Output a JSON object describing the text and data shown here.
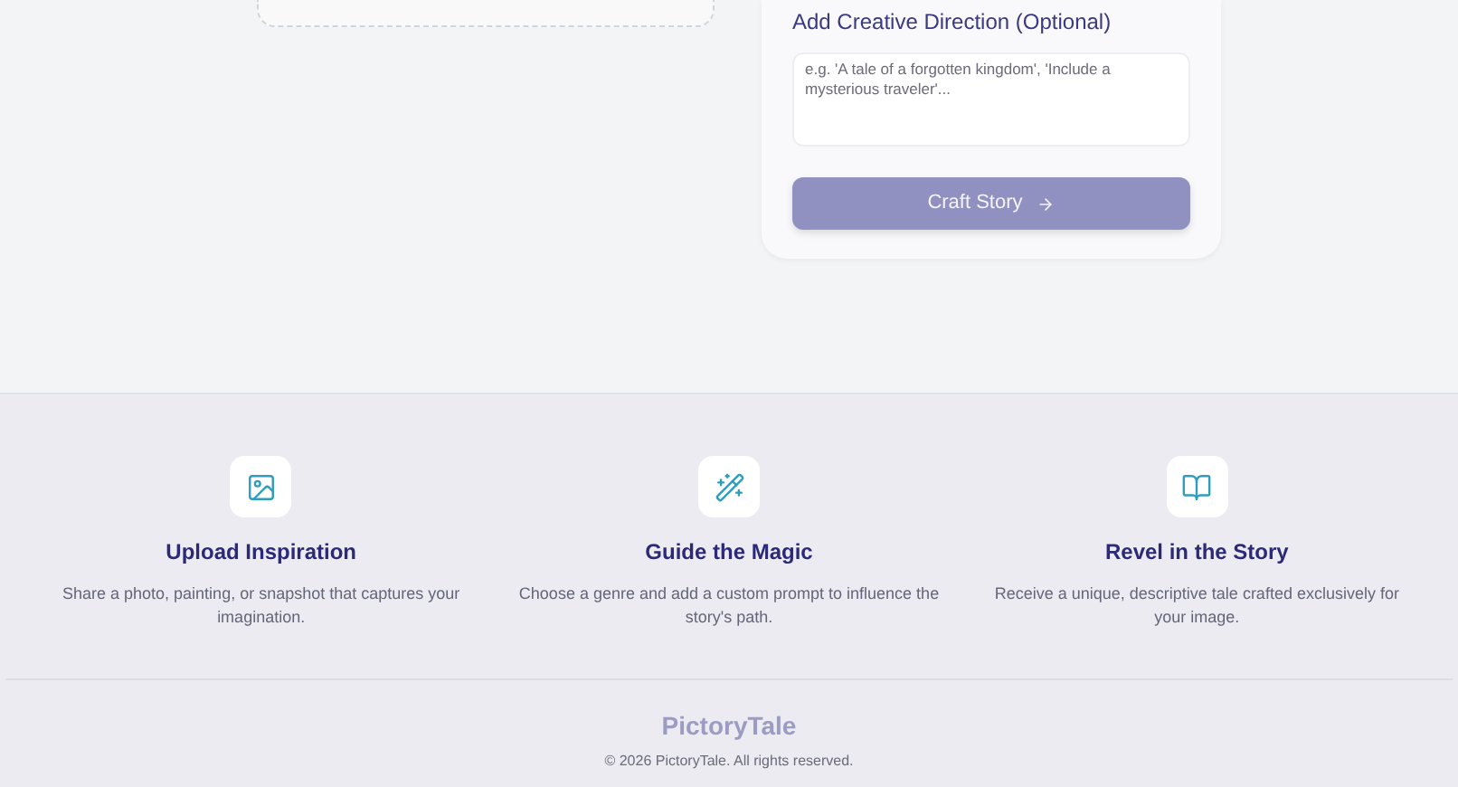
{
  "creative_direction": {
    "label": "Add Creative Direction (Optional)",
    "placeholder": "e.g. 'A tale of a forgotten kingdom', 'Include a mysterious traveler'..."
  },
  "submit_button": {
    "label": "Craft Story",
    "disabled": true
  },
  "features": [
    {
      "kind": "image",
      "title": "Upload Inspiration",
      "text": "Share a photo, painting, or snapshot that captures your imagination."
    },
    {
      "kind": "wand",
      "title": "Guide the Magic",
      "text": "Choose a genre and add a custom prompt to influence the story's path."
    },
    {
      "kind": "book",
      "title": "Revel in the Story",
      "text": "Receive a unique, descriptive tale crafted exclusively for your image."
    }
  ],
  "footer": {
    "brand": "PictoryTale",
    "copyright": "© 2026 PictoryTale. All rights reserved."
  }
}
